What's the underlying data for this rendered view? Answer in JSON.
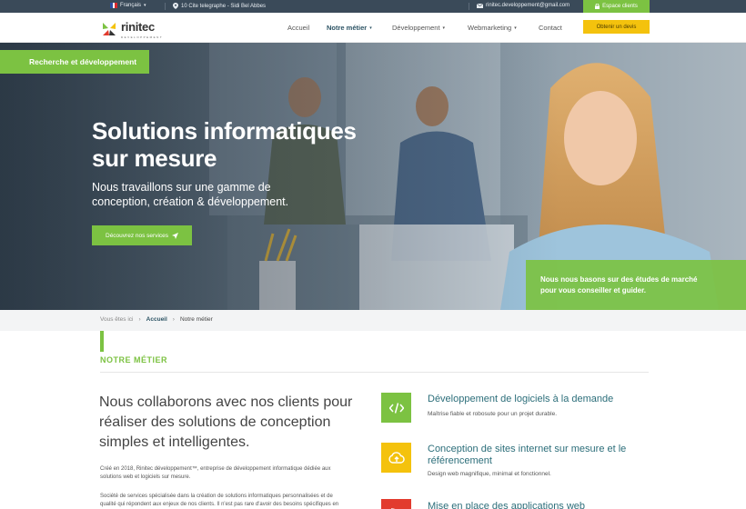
{
  "topbar": {
    "language": "Français",
    "address": "10 Cite telegraphe - Sidi Bel Abbes",
    "email": "rinitec.developpement@gmail.com",
    "client_area": "Espace clients"
  },
  "header": {
    "brand": "rinitec",
    "brand_sub": "DEVELOPPEMENT",
    "nav": [
      {
        "label": "Accueil"
      },
      {
        "label": "Notre métier"
      },
      {
        "label": "Développement"
      },
      {
        "label": "Webmarketing"
      },
      {
        "label": "Contact"
      }
    ],
    "quote_button": "Obtenir un devis"
  },
  "hero": {
    "ribbon": "Recherche et développement",
    "title_line1": "Solutions informatiques",
    "title_line2": "sur mesure",
    "subtitle_line1": "Nous travaillons sur une gamme de",
    "subtitle_line2": "conception, création & développement.",
    "cta": "Découvrez nos services",
    "box_line1": "Nous nous basons sur des études de marché",
    "box_line2": "pour vous conseiller et guider."
  },
  "breadcrumb": {
    "prefix": "Vous êtes ici",
    "home": "Accueil",
    "current": "Notre métier"
  },
  "section": {
    "title": "NOTRE MÉTIER",
    "lead": "Nous collaborons avec nos clients pour réaliser des solutions de conception simples et intelligentes.",
    "para1_line1": "Créé en 2018, Rinitec développement™, entreprise de développement informatique dédiée aux",
    "para1_line2": "solutions web et logiciels sur mesure.",
    "para2_line1": "Société de services spécialisée dans la création de solutions informatiques personnalisées et de",
    "para2_line2": "qualité qui répondent aux enjeux de nos clients. Il n'est pas rare d'avoir des besoins spécifiques en"
  },
  "services": [
    {
      "title": "Développement de logiciels à la demande",
      "desc": "Maîtrise fiable et robosute pour un projet durable.",
      "color": "#7cc242",
      "icon": "code-icon"
    },
    {
      "title": "Conception de sites internet sur mesure et le référencement",
      "desc": "Design web magnifique, minimal et fonctionnel.",
      "color": "#f4c20d",
      "icon": "cloud-upload-icon"
    },
    {
      "title": "Mise en place des applications web",
      "desc": "",
      "color": "#e23b2e",
      "icon": "rss-icon"
    }
  ],
  "colors": {
    "accent_green": "#7cc242",
    "accent_yellow": "#f4c20d",
    "topbar": "#3a4a59",
    "teal_text": "#2c6e7a"
  }
}
